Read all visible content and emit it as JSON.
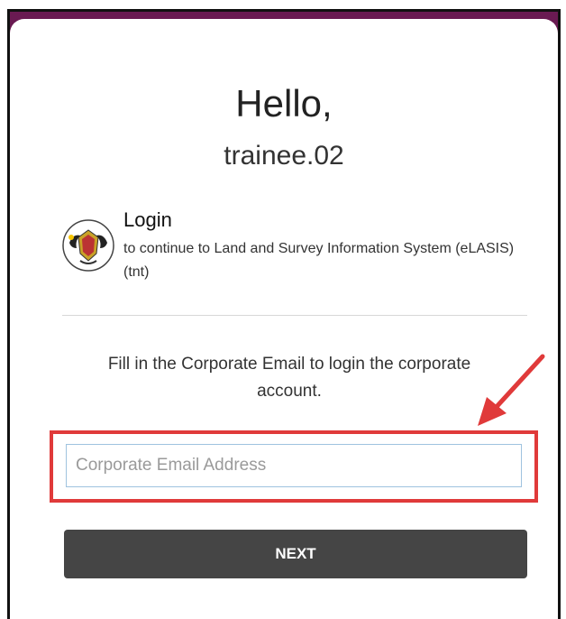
{
  "greeting": {
    "hello": "Hello,",
    "username": "trainee.02"
  },
  "login": {
    "title": "Login",
    "description": "to continue to Land and Survey Information System (eLASIS) (tnt)",
    "logo_icon": "state-crest-icon"
  },
  "instruction": "Fill in the Corporate Email to login the corporate account.",
  "email": {
    "placeholder": "Corporate Email Address",
    "value": ""
  },
  "next_button_label": "NEXT",
  "colors": {
    "background_accent": "#6a1a52",
    "button": "#454545",
    "annotation_red": "#e03a3a",
    "input_border": "#9fc3df"
  }
}
